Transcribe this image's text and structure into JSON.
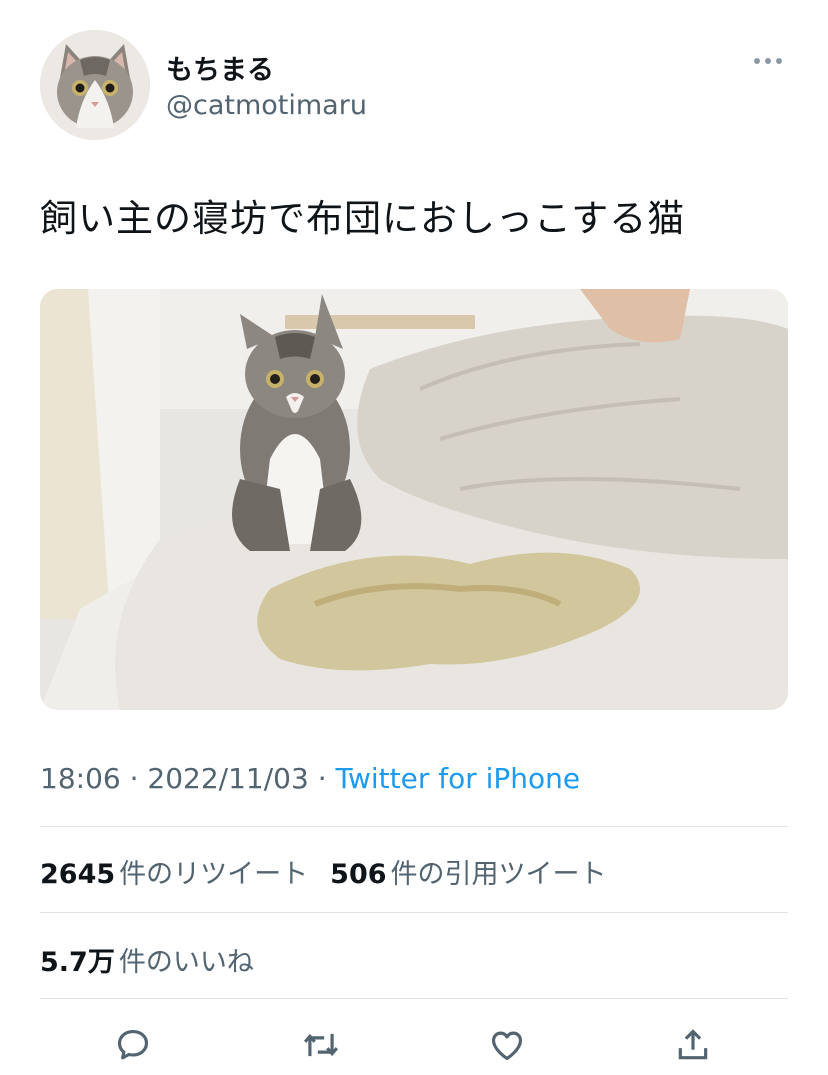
{
  "user": {
    "display_name": "もちまる",
    "handle": "@catmotimaru"
  },
  "tweet": {
    "text": "飼い主の寝坊で布団におしっこする猫",
    "time": "18:06",
    "separator": " · ",
    "date": "2022/11/03",
    "source": "Twitter for iPhone"
  },
  "stats": {
    "retweets_count": "2645",
    "retweets_label": "件のリツイート",
    "quotes_count": "506",
    "quotes_label": "件の引用ツイート",
    "likes_count": "5.7万",
    "likes_label": "件のいいね"
  },
  "actions": [
    "reply-icon",
    "retweet-icon",
    "like-icon",
    "share-icon"
  ],
  "colors": {
    "link": "#1d9bf0",
    "secondary_text": "#536471",
    "primary_text": "#0f1419",
    "divider": "#dfe3e6"
  }
}
